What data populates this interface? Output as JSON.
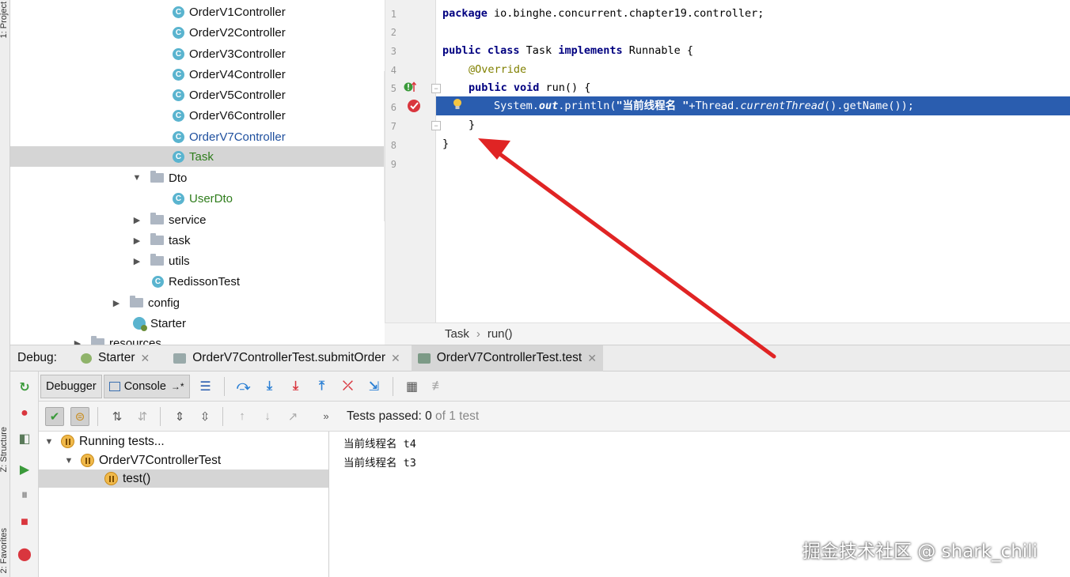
{
  "side_tabs": {
    "project": "1: Project",
    "structure": "Z: Structure",
    "favorites": "2: Favorites"
  },
  "tree": {
    "items": [
      {
        "label": "OrderV1Controller",
        "kind": "class"
      },
      {
        "label": "OrderV2Controller",
        "kind": "class"
      },
      {
        "label": "OrderV3Controller",
        "kind": "class"
      },
      {
        "label": "OrderV4Controller",
        "kind": "class"
      },
      {
        "label": "OrderV5Controller",
        "kind": "class"
      },
      {
        "label": "OrderV6Controller",
        "kind": "class"
      },
      {
        "label": "OrderV7Controller",
        "kind": "class",
        "color": "#1e4f9e"
      },
      {
        "label": "Task",
        "kind": "class",
        "color": "#2f7d1c",
        "selected": true
      },
      {
        "label": "Dto",
        "kind": "folder",
        "expanded": true
      },
      {
        "label": "UserDto",
        "kind": "class",
        "color": "#2f7d1c"
      },
      {
        "label": "service",
        "kind": "folder",
        "expanded": false
      },
      {
        "label": "task",
        "kind": "folder",
        "expanded": false
      },
      {
        "label": "utils",
        "kind": "folder",
        "expanded": false
      },
      {
        "label": "RedissonTest",
        "kind": "class"
      },
      {
        "label": "config",
        "kind": "folder",
        "expanded": false
      },
      {
        "label": "Starter",
        "kind": "starter"
      },
      {
        "label": "resources",
        "kind": "folder",
        "expanded": false
      }
    ]
  },
  "editor": {
    "line_numbers": [
      "1",
      "2",
      "3",
      "4",
      "5",
      "6",
      "7",
      "8",
      "9"
    ],
    "code": {
      "l1_kw": "package",
      "l1_rest": " io.binghe.concurrent.chapter19.controller;",
      "l3_kw1": "public class",
      "l3_mid": " Task ",
      "l3_kw2": "implements",
      "l3_rest": " Runnable {",
      "l4_ann": "@Override",
      "l5_kw": "public void",
      "l5_rest": " run() {",
      "l6_pre": "System.",
      "l6_out": "out",
      "l6_mid": ".println(",
      "l6_str": "\"当前线程名 \"",
      "l6_plus": "+Thread.",
      "l6_ct": "currentThread",
      "l6_rest": "().getName());",
      "l7": "}",
      "l8": "}"
    },
    "breadcrumb": [
      "Task",
      "run()"
    ]
  },
  "debug": {
    "label": "Debug:",
    "tabs": [
      {
        "label": "Starter"
      },
      {
        "label": "OrderV7ControllerTest.submitOrder"
      },
      {
        "label": "OrderV7ControllerTest.test",
        "active": true
      }
    ],
    "debugger_tab": "Debugger",
    "console_tab": "Console",
    "console_suffix": "→*"
  },
  "tests": {
    "status_prefix": "Tests passed: ",
    "status_count": "0",
    "status_suffix": " of 1 test",
    "tree": [
      {
        "label": "Running tests..."
      },
      {
        "label": "OrderV7ControllerTest"
      },
      {
        "label": "test()",
        "selected": true
      }
    ]
  },
  "console": {
    "lines": [
      "当前线程名 t4",
      "当前线程名 t3"
    ]
  },
  "watermark": "掘金技术社区 @ shark_chili",
  "colors": {
    "highlight": "#2a5daf",
    "arrow": "#e02424",
    "keyword": "#000080",
    "annotation": "#808000"
  }
}
